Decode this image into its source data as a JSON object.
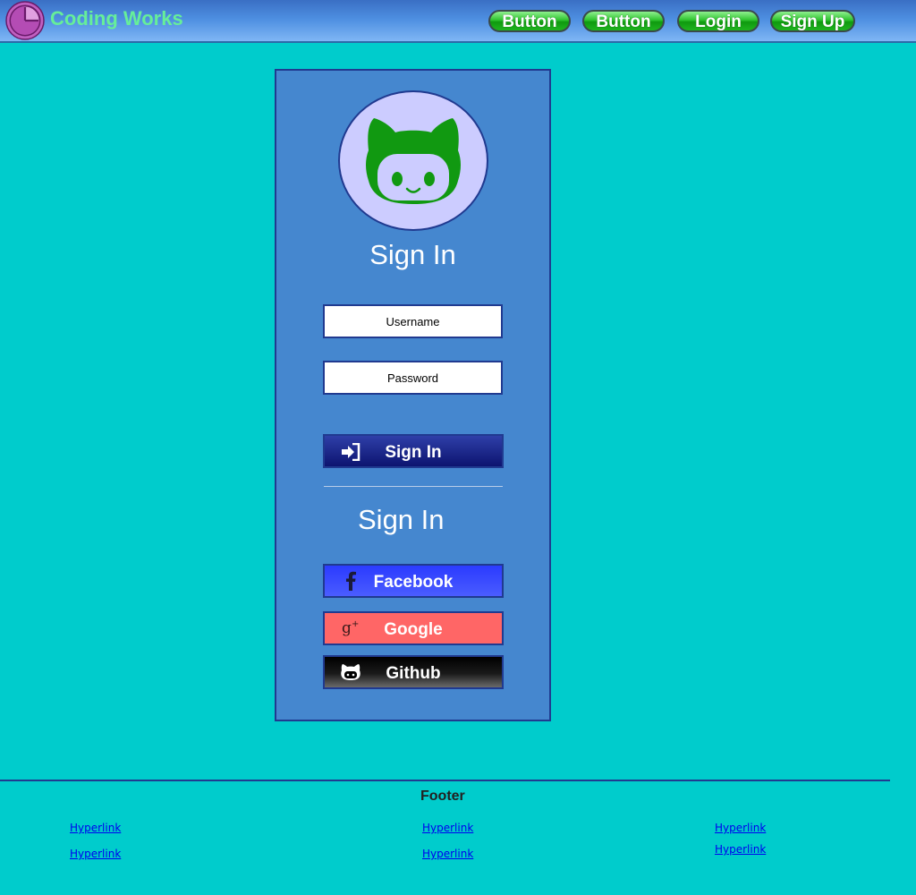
{
  "header": {
    "brand": "Coding Works",
    "nav": [
      {
        "label": "Button"
      },
      {
        "label": "Button"
      },
      {
        "label": "Login"
      },
      {
        "label": "Sign Up"
      }
    ]
  },
  "login": {
    "title": "Sign In",
    "username_placeholder": "Username",
    "password_placeholder": "Password",
    "submit_label": "Sign In",
    "social_title": "Sign In",
    "social": [
      {
        "label": "Facebook",
        "icon": "facebook-icon",
        "color": "#3347ff"
      },
      {
        "label": "Google",
        "icon": "google-plus-icon",
        "color": "#ff6666"
      },
      {
        "label": "Github",
        "icon": "github-icon",
        "color": "#000000"
      }
    ]
  },
  "footer": {
    "title": "Footer",
    "columns": [
      [
        "Hyperlink",
        "Hyperlink"
      ],
      [
        "Hyperlink",
        "Hyperlink"
      ],
      [
        "Hyperlink",
        "Hyperlink"
      ]
    ]
  },
  "colors": {
    "background": "#00cccc",
    "panel": "#4587cf",
    "accent_green": "#22bb22",
    "avatar_bg": "#ccccff",
    "octocat": "#119911"
  }
}
